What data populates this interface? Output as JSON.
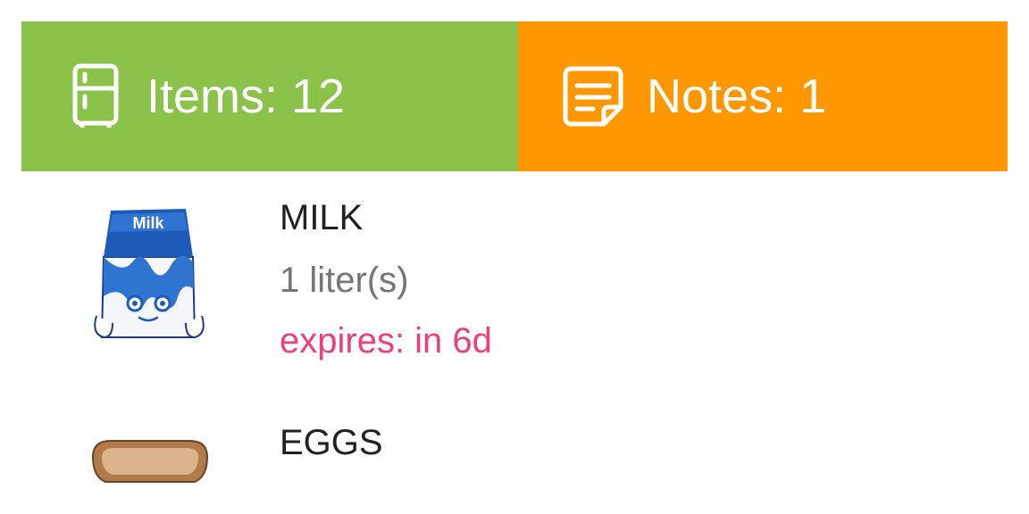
{
  "tabs": {
    "items": {
      "label": "Items: 12",
      "icon": "fridge-icon",
      "color": "#8bc34a"
    },
    "notes": {
      "label": "Notes: 1",
      "icon": "note-icon",
      "color": "#ff9800"
    }
  },
  "items": [
    {
      "name": "MILK",
      "quantity": "1 liter(s)",
      "expires": "expires: in 6d",
      "expires_color": "#ec407a",
      "icon": "milk-carton-icon",
      "image_text": "Milk"
    },
    {
      "name": "EGGS",
      "icon": "egg-carton-icon"
    }
  ]
}
